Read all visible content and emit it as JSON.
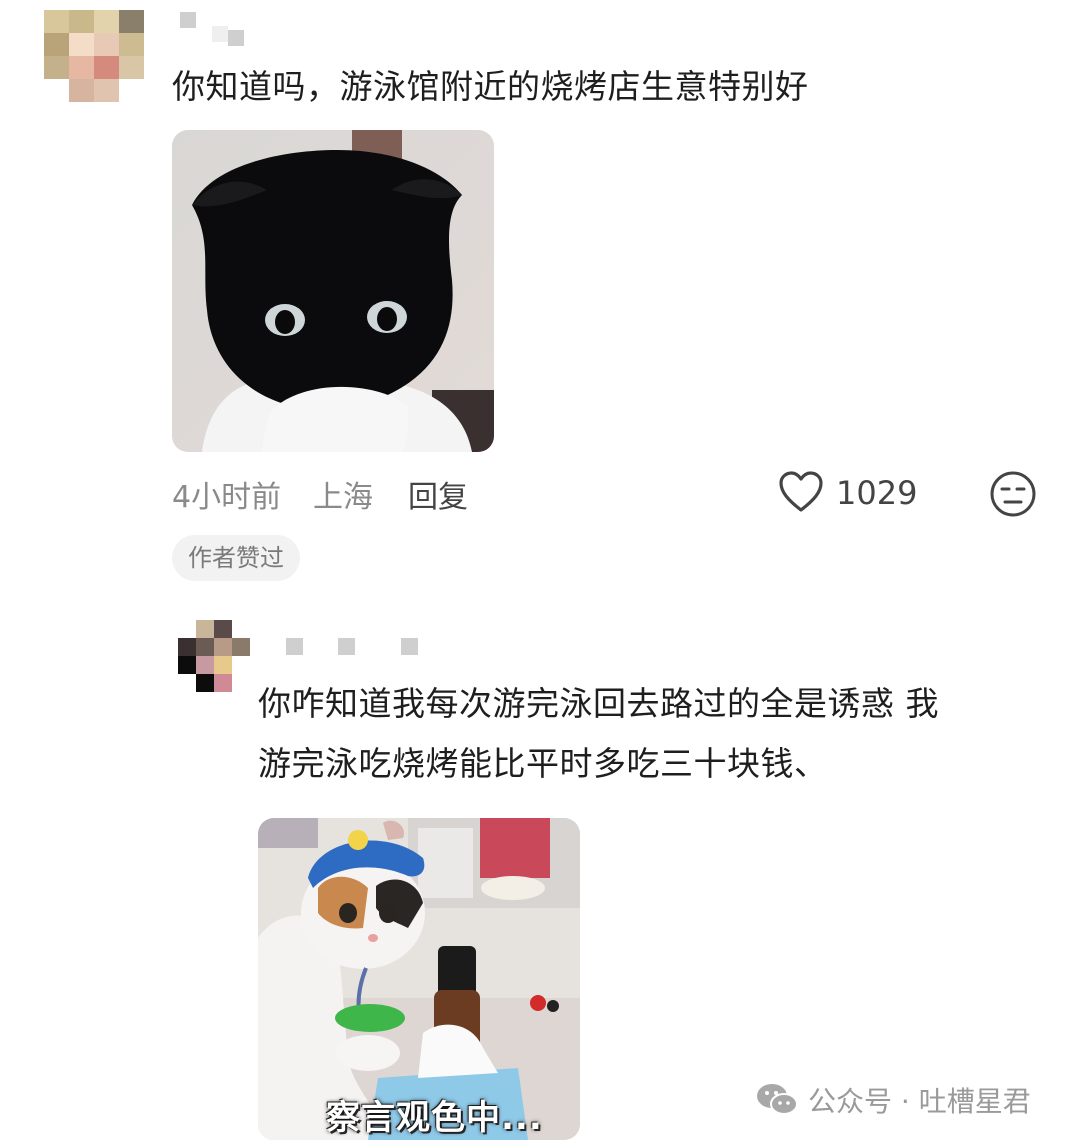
{
  "comment1": {
    "username_masked": true,
    "text": "你知道吗，游泳馆附近的烧烤店生意特别好",
    "image_icon": "black-scottish-fold-cat-photo",
    "time": "4小时前",
    "location": "上海",
    "reply_label": "回复",
    "like_count": "1029",
    "badge": "作者赞过"
  },
  "comment2": {
    "username_masked": true,
    "text_line1": "你咋知道我每次游完泳回去路过的全是诱惑 我",
    "text_line2": "游完泳吃烧烤能比平时多吃三十块钱、",
    "image_icon": "calico-cat-in-knitted-hat-photo",
    "image_caption": "察言观色中..."
  },
  "watermark": {
    "text": "公众号 · 吐槽星君",
    "icon": "wechat-icon"
  },
  "colors": {
    "text": "#1e1e1e",
    "meta": "#8a8a8a",
    "badge_bg": "#f2f2f2"
  }
}
